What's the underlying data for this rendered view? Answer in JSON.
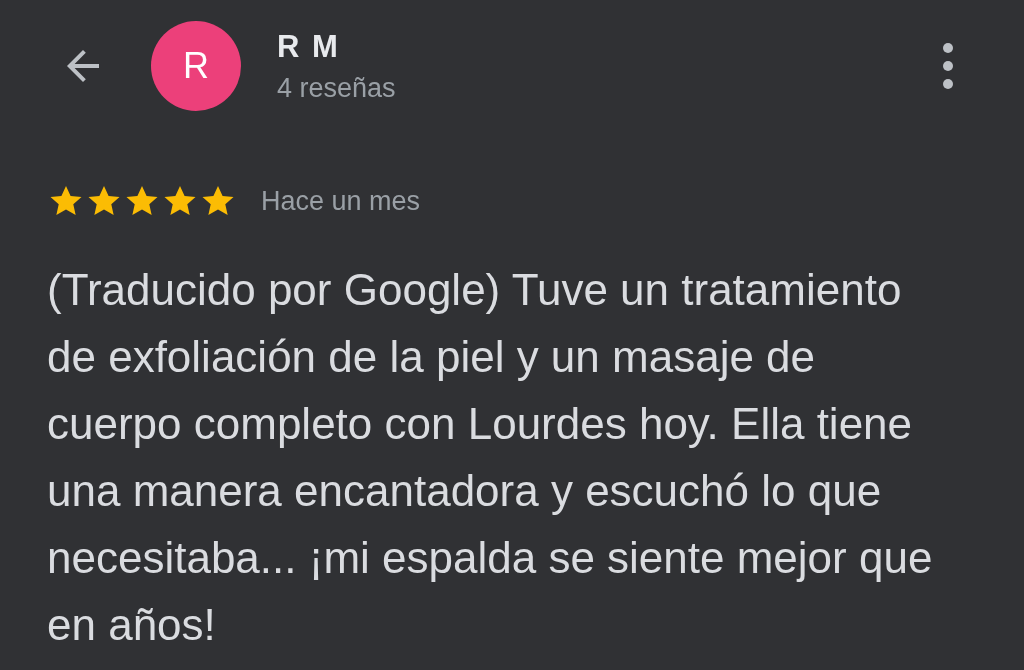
{
  "header": {
    "avatar_letter": "R",
    "name": "R M",
    "review_count": "4 reseñas"
  },
  "review": {
    "stars": 5,
    "time": "Hace un mes",
    "text": "(Traducido por Google) Tuve un tratamiento de exfoliación de la piel y un masaje de cuerpo completo con Lourdes hoy. Ella tiene una manera encantadora y escuchó lo que necesitaba... ¡mi espalda se siente mejor que en años!"
  }
}
